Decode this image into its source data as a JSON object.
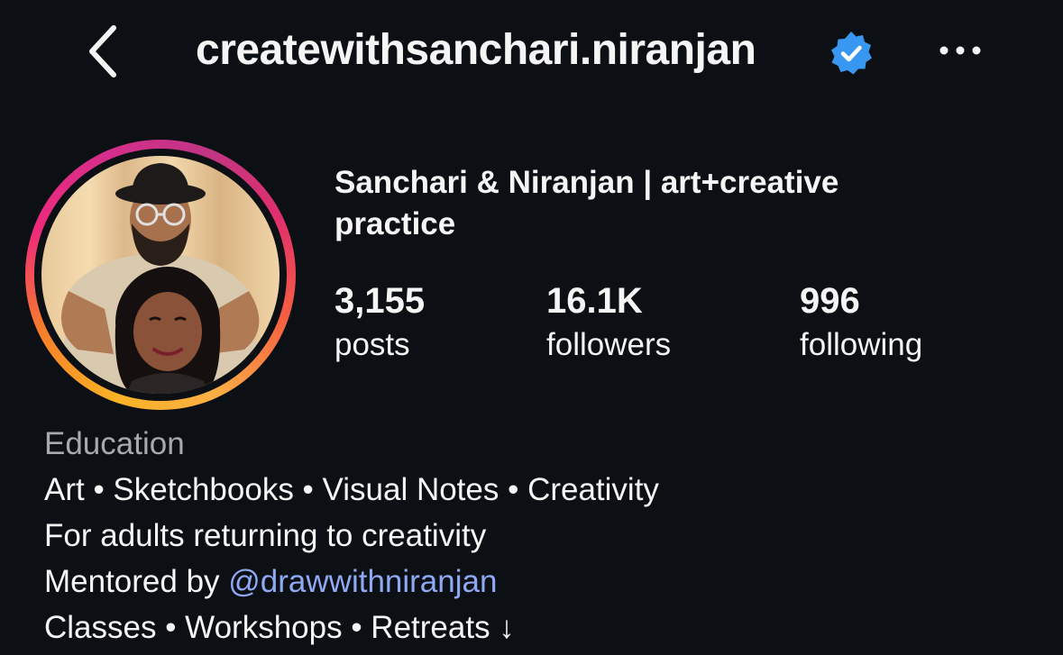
{
  "header": {
    "username": "createwithsanchari.niranjan",
    "back_icon": "chevron-left-icon",
    "verified_icon": "verified-badge-icon",
    "more_icon": "more-horizontal-icon",
    "verified_color": "#3897f0"
  },
  "profile": {
    "display_name": "Sanchari & Niranjan | art+creative practice",
    "stats": {
      "posts": {
        "value": "3,155",
        "label": "posts"
      },
      "followers": {
        "value": "16.1K",
        "label": "followers"
      },
      "following": {
        "value": "996",
        "label": "following"
      }
    }
  },
  "bio": {
    "category": "Education",
    "line1": "Art • Sketchbooks • Visual Notes • Creativity",
    "line2": "For adults returning to creativity",
    "line3_prefix": "Mentored by ",
    "line3_mention": "@drawwithniranjan",
    "line4": "Classes • Workshops • Retreats ↓"
  },
  "colors": {
    "background": "#0c0f14",
    "text": "#f5f5f5",
    "category_text": "#a8a8ae",
    "mention": "#8fa9f5"
  }
}
